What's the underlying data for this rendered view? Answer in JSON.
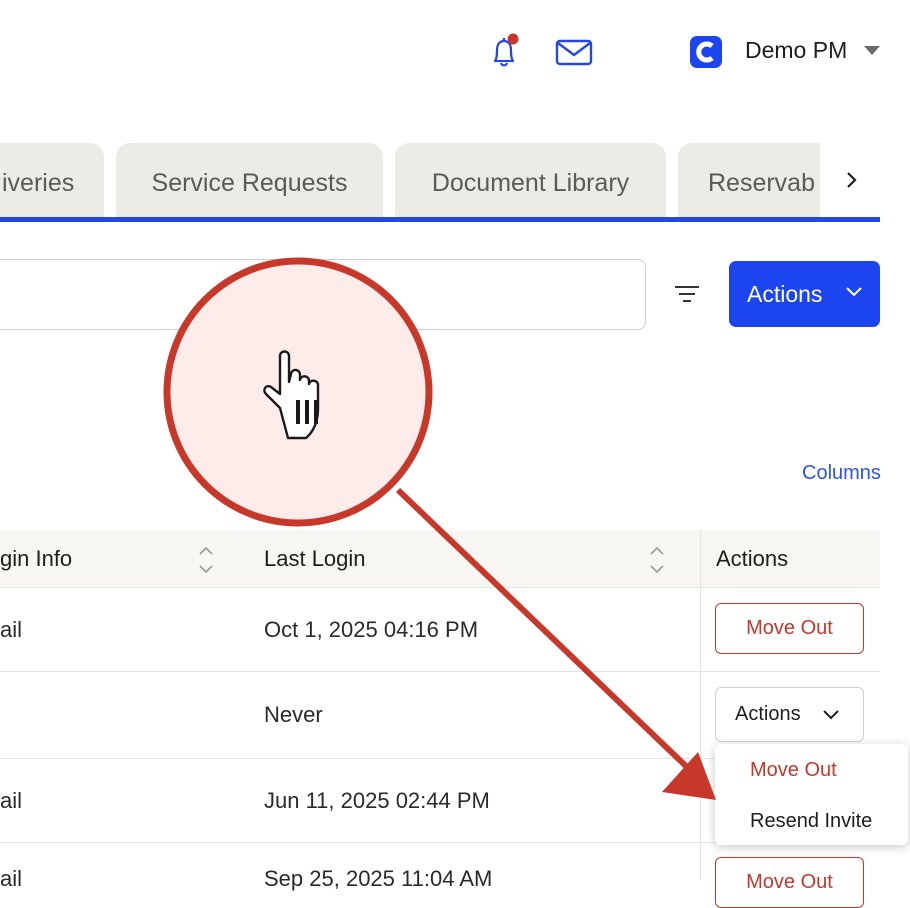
{
  "header": {
    "user_name": "Demo PM"
  },
  "tabs": [
    {
      "label": "iveries"
    },
    {
      "label": "Service Requests"
    },
    {
      "label": "Document Library"
    },
    {
      "label": "Reservab"
    }
  ],
  "toolbar": {
    "actions_label": "Actions",
    "columns_label": "Columns"
  },
  "table": {
    "columns": [
      "gin Info",
      "Last Login",
      "Actions"
    ],
    "rows": [
      {
        "login_info": "ail",
        "last_login": "Oct 1, 2025 04:16 PM",
        "action": "Move Out"
      },
      {
        "login_info": "",
        "last_login": "Never",
        "action": "Actions"
      },
      {
        "login_info": "ail",
        "last_login": "Jun 11, 2025 02:44 PM",
        "action": ""
      },
      {
        "login_info": "ail",
        "last_login": "Sep 25, 2025 11:04 AM",
        "action": "Move Out"
      }
    ]
  },
  "dropdown": {
    "items": [
      "Move Out",
      "Resend Invite"
    ]
  },
  "colors": {
    "primary": "#1c45f0",
    "danger": "#c0392b",
    "tab_bg": "#edebe6",
    "annotation": "#c8382a"
  },
  "icons": [
    "bell-icon",
    "mail-icon",
    "app-logo-icon",
    "caret-down-icon",
    "chevron-right-icon",
    "filter-icon",
    "chevron-down-icon",
    "sort-icon",
    "hand-cursor-icon"
  ]
}
